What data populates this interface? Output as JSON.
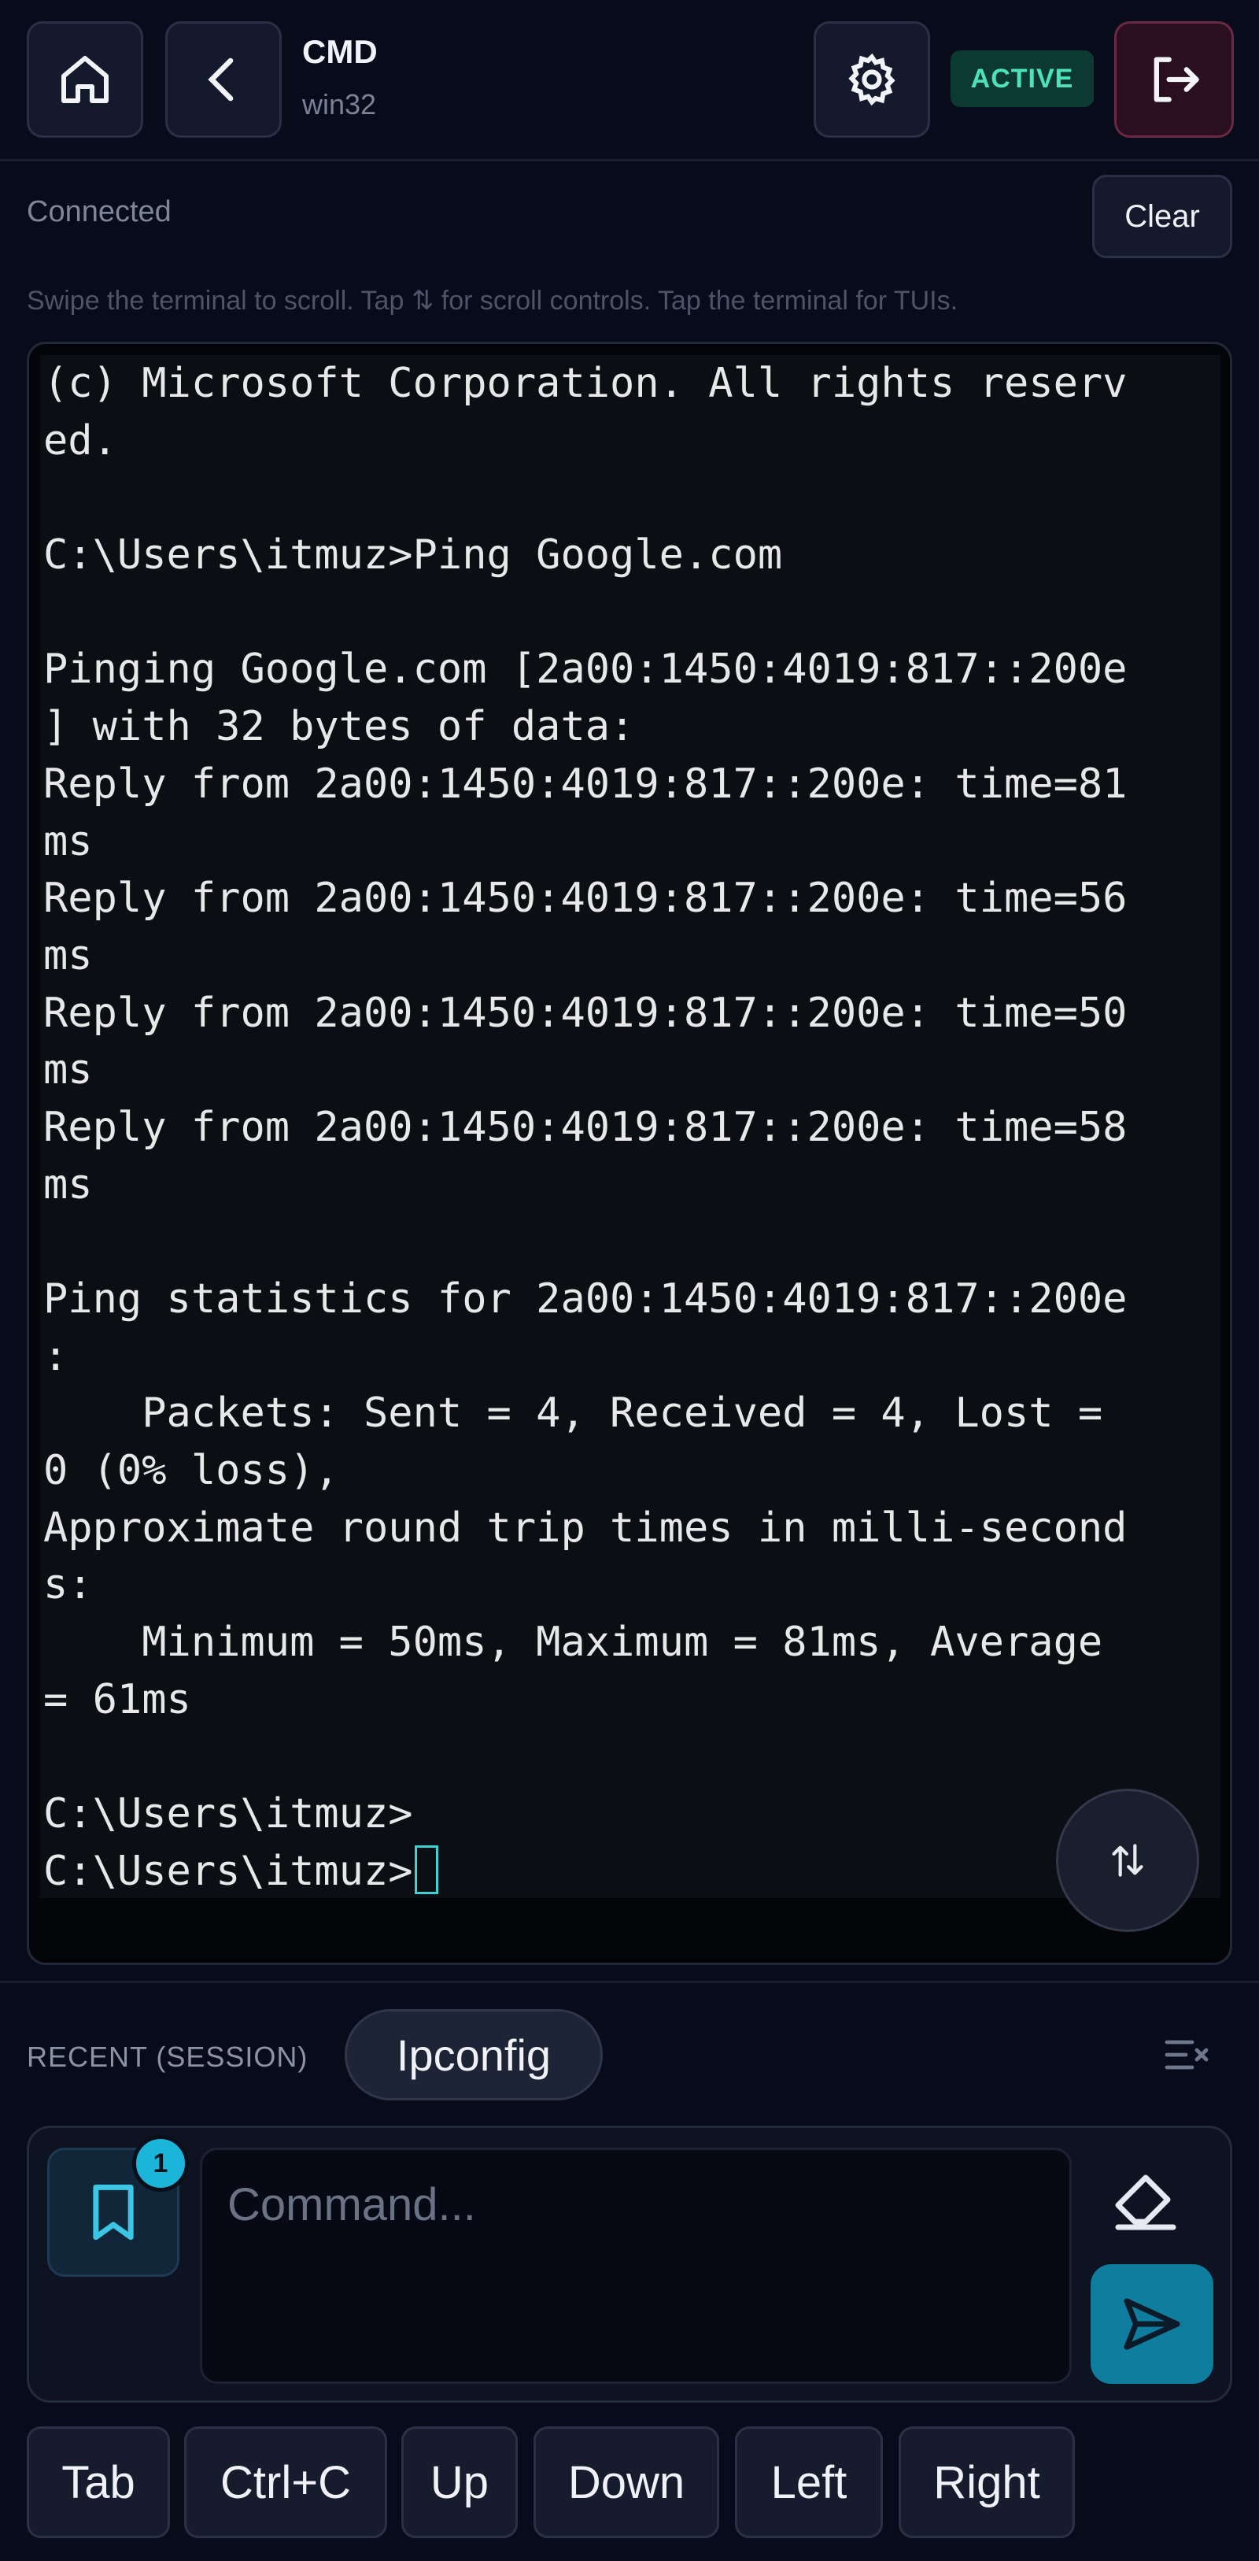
{
  "header": {
    "title": "CMD",
    "subtitle": "win32",
    "status_badge": "ACTIVE",
    "icons": [
      "home-icon",
      "chevron-left-icon",
      "gear-icon",
      "logout-icon"
    ]
  },
  "connection": {
    "status": "Connected",
    "clear_label": "Clear",
    "hint": "Swipe the terminal to scroll. Tap ⇅ for scroll controls. Tap the terminal for TUIs."
  },
  "terminal": {
    "lines": [
      "(c) Microsoft Corporation. All rights reserv",
      "ed.",
      "",
      "C:\\Users\\itmuz>Ping Google.com",
      "",
      "Pinging Google.com [2a00:1450:4019:817::200e",
      "] with 32 bytes of data:",
      "Reply from 2a00:1450:4019:817::200e: time=81",
      "ms",
      "Reply from 2a00:1450:4019:817::200e: time=56",
      "ms",
      "Reply from 2a00:1450:4019:817::200e: time=50",
      "ms",
      "Reply from 2a00:1450:4019:817::200e: time=58",
      "ms",
      "",
      "Ping statistics for 2a00:1450:4019:817::200e",
      ":",
      "    Packets: Sent = 4, Received = 4, Lost =",
      "0 (0% loss),",
      "Approximate round trip times in milli-second",
      "s:",
      "    Minimum = 50ms, Maximum = 81ms, Average",
      "= 61ms",
      "",
      "C:\\Users\\itmuz>"
    ],
    "prompt": "C:\\Users\\itmuz>",
    "accent": "#3fd0cf"
  },
  "recent": {
    "label": "RECENT (SESSION)",
    "items": [
      "Ipconfig"
    ]
  },
  "input": {
    "placeholder": "Command...",
    "value": "",
    "bookmark_count": "1",
    "send_color": "#0f7e9e"
  },
  "keys": [
    "Tab",
    "Ctrl+C",
    "Up",
    "Down",
    "Left",
    "Right"
  ]
}
